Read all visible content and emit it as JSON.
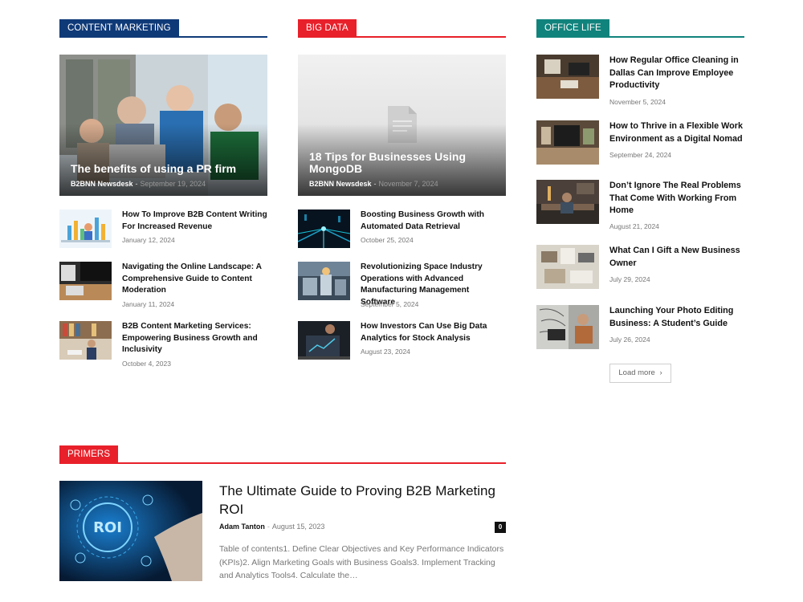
{
  "content_marketing": {
    "tag": "CONTENT MARKETING",
    "hero": {
      "title": "The benefits of using a PR firm",
      "author": "B2BNN Newsdesk",
      "sep": "-",
      "date": "September 19, 2024"
    },
    "items": [
      {
        "title": "How To Improve B2B Content Writing For Increased Revenue",
        "date": "January 12, 2024"
      },
      {
        "title": "Navigating the Online Landscape: A Comprehensive Guide to Content Moderation",
        "date": "January 11, 2024"
      },
      {
        "title": "B2B Content Marketing Services: Empowering Business Growth and Inclusivity",
        "date": "October 4, 2023"
      }
    ]
  },
  "big_data": {
    "tag": "BIG DATA",
    "hero": {
      "title": "18 Tips for Businesses Using MongoDB",
      "author": "B2BNN Newsdesk",
      "sep": "-",
      "date": "November 7, 2024"
    },
    "items": [
      {
        "title": "Boosting Business Growth with Automated Data Retrieval",
        "date": "October 25, 2024"
      },
      {
        "title": "Revolutionizing Space Industry Operations with Advanced Manufacturing Management Software",
        "date": "September 5, 2024"
      },
      {
        "title": "How Investors Can Use Big Data Analytics for Stock Analysis",
        "date": "August 23, 2024"
      }
    ]
  },
  "office_life": {
    "tag": "OFFICE LIFE",
    "items": [
      {
        "title": "How Regular Office Cleaning in Dallas Can Improve Employee Productivity",
        "date": "November 5, 2024"
      },
      {
        "title": "How to Thrive in a Flexible Work Environment as a Digital Nomad",
        "date": "September 24, 2024"
      },
      {
        "title": "Don’t Ignore The Real Problems That Come With Working From Home",
        "date": "August 21, 2024"
      },
      {
        "title": "What Can I Gift a New Business Owner",
        "date": "July 29, 2024"
      },
      {
        "title": "Launching Your Photo Editing Business: A Student’s Guide",
        "date": "July 26, 2024"
      }
    ],
    "load_more": "Load more",
    "load_more_icon": "chevron-right-icon"
  },
  "primers": {
    "tag": "PRIMERS",
    "article": {
      "title": "The Ultimate Guide to Proving B2B Marketing ROI",
      "author": "Adam Tanton",
      "sep": "-",
      "date": "August 15, 2023",
      "comments": "0",
      "excerpt": "Table of contents1. Define Clear Objectives and Key Performance Indicators (KPIs)2. Align Marketing Goals with Business Goals3. Implement Tracking and Analytics Tools4. Calculate the…",
      "image_text": "ROI"
    }
  },
  "colors": {
    "content_marketing": "#0f3a78",
    "big_data": "#e8202a",
    "office_life": "#10837c",
    "primers": "#e8202a"
  }
}
